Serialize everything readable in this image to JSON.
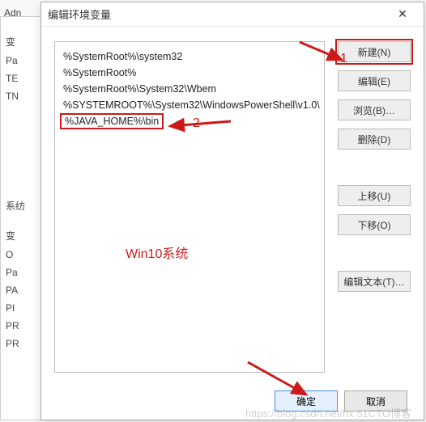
{
  "bg": {
    "label0": "Adn",
    "label1": "变",
    "label2": "Pa",
    "label3": "TE",
    "label4": "TN",
    "label5": "系纺",
    "label6": "变",
    "label7": "O",
    "label8": "Pa",
    "label9": "PA",
    "label10": "PI",
    "label11": "PR",
    "label12": "PR"
  },
  "dialog": {
    "title": "编辑环境变量",
    "close": "✕",
    "list": [
      "%SystemRoot%\\system32",
      "%SystemRoot%",
      "%SystemRoot%\\System32\\Wbem",
      "%SYSTEMROOT%\\System32\\WindowsPowerShell\\v1.0\\",
      "%JAVA_HOME%\\bin"
    ],
    "buttons": {
      "new": "新建(N)",
      "edit": "编辑(E)",
      "browse": "浏览(B)…",
      "delete": "删除(D)",
      "moveUp": "上移(U)",
      "moveDown": "下移(O)",
      "editText": "编辑文本(T)…"
    },
    "footer": {
      "ok": "确定",
      "cancel": "取消"
    }
  },
  "annotations": {
    "num1": "1",
    "num2": "2",
    "caption": "Win10系统",
    "watermark": "https://blog.csdn.net/hx 51CTO博客"
  }
}
